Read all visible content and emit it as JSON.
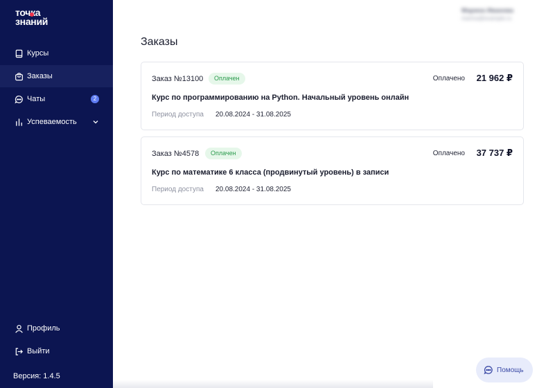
{
  "logo": {
    "line1": "точка",
    "line2": "знаний"
  },
  "sidebar": {
    "items": [
      {
        "label": "Курсы",
        "icon": "book-icon"
      },
      {
        "label": "Заказы",
        "icon": "bag-icon"
      },
      {
        "label": "Чаты",
        "icon": "chat-icon",
        "badge": "2"
      },
      {
        "label": "Успеваемость",
        "icon": "bar-chart-icon"
      }
    ],
    "profile_label": "Профиль",
    "logout_label": "Выйти",
    "version": "Версия: 1.4.5"
  },
  "user": {
    "name": "Марина Иванова",
    "email": "marina@example.ru"
  },
  "page": {
    "title": "Заказы"
  },
  "orders": [
    {
      "number": "Заказ №13100",
      "status": "Оплачен",
      "paid_label": "Оплачено",
      "price": "21 962 ₽",
      "course": "Курс по программированию на Python. Начальный уровень онлайн",
      "period_label": "Период доступа",
      "period": "20.08.2024 - 31.08.2025"
    },
    {
      "number": "Заказ №4578",
      "status": "Оплачен",
      "paid_label": "Оплачено",
      "price": "37 737 ₽",
      "course": "Курс по математике 6 класса (продвинутый уровень) в записи",
      "period_label": "Период доступа",
      "period": "20.08.2024 - 31.08.2025"
    }
  ],
  "help": {
    "label": "Помощь"
  },
  "colors": {
    "sidebar_bg": "#0c1551",
    "sidebar_active": "#17215e",
    "logo_accent": "#f0324a",
    "badge": "#5f7cf2",
    "status_bg": "#e6f7ea",
    "status_text": "#2a9a4c",
    "help_bg": "#e8ecfb"
  }
}
